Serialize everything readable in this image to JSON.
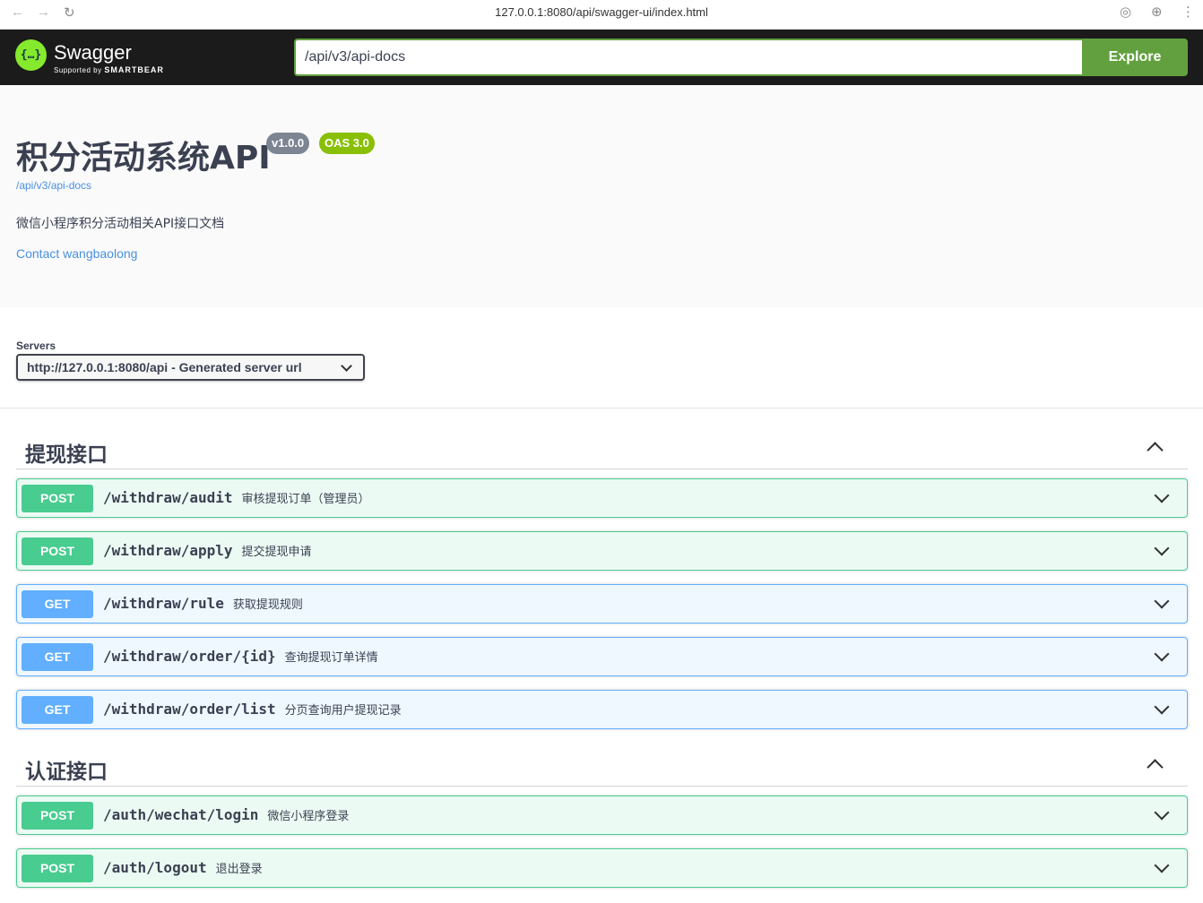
{
  "browser": {
    "url": "127.0.0.1:8080/api/swagger-ui/index.html"
  },
  "topbar": {
    "logo_icon_text": "{…}",
    "logo_text": "Swagger",
    "logo_sub_prefix": "Supported by",
    "logo_sub_brand": "SMARTBEAR",
    "explore_input_value": "/api/v3/api-docs",
    "explore_button_label": "Explore"
  },
  "info": {
    "title": "积分活动系统API",
    "version_badge": "v1.0.0",
    "oas_badge": "OAS 3.0",
    "docs_link": "/api/v3/api-docs",
    "description": "微信小程序积分活动相关API接口文档",
    "contact": "Contact wangbaolong"
  },
  "servers": {
    "label": "Servers",
    "selected": "http://127.0.0.1:8080/api - Generated server url"
  },
  "tags": [
    {
      "name": "提现接口",
      "operations": [
        {
          "method": "POST",
          "path": "/withdraw/audit",
          "summary": "审核提现订单（管理员）"
        },
        {
          "method": "POST",
          "path": "/withdraw/apply",
          "summary": "提交提现申请"
        },
        {
          "method": "GET",
          "path": "/withdraw/rule",
          "summary": "获取提现规则"
        },
        {
          "method": "GET",
          "path": "/withdraw/order/{id}",
          "summary": "查询提现订单详情"
        },
        {
          "method": "GET",
          "path": "/withdraw/order/list",
          "summary": "分页查询用户提现记录"
        }
      ]
    },
    {
      "name": "认证接口",
      "operations": [
        {
          "method": "POST",
          "path": "/auth/wechat/login",
          "summary": "微信小程序登录"
        },
        {
          "method": "POST",
          "path": "/auth/logout",
          "summary": "退出登录"
        }
      ]
    }
  ],
  "colors": {
    "post": "#49cc90",
    "get": "#61affe",
    "topbar_bg": "#1b1b1b",
    "explore": "#62a03f",
    "link": "#4990e2"
  }
}
